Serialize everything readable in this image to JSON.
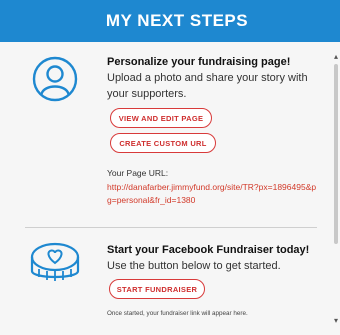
{
  "header": {
    "title": "MY NEXT STEPS"
  },
  "step1": {
    "heading": "Personalize your fundraising page!",
    "body": " Upload a photo and share your story with your supporters.",
    "view_edit_button": "VIEW AND EDIT PAGE",
    "custom_url_button": "CREATE CUSTOM URL",
    "url_label": "Your Page URL:",
    "url": "http://danafarber.jimmyfund.org/site/TR?px=1896495&pg=personal&fr_id=1380"
  },
  "step2": {
    "heading": "Start your Facebook Fundraiser today!",
    "body": " Use the button below to get started.",
    "start_button": "START FUNDRAISER",
    "note": "Once started, your fundraiser link will appear here."
  },
  "icons": {
    "step1": "user-avatar-icon",
    "step2": "donation-coin-icon"
  },
  "colors": {
    "header_bg": "#1e88d0",
    "accent_red": "#d83a3a",
    "icon_blue": "#1e88d0",
    "panel_bg": "#f6f6f6"
  }
}
